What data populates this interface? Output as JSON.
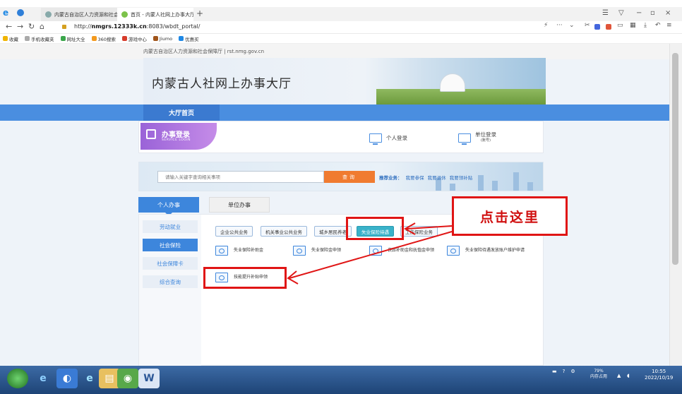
{
  "browser": {
    "tabs": [
      {
        "title": "内蒙古自治区人力资源和社会...",
        "close": "×"
      },
      {
        "title": "首页 - 内蒙人社网上办事大厅",
        "close": "×"
      }
    ],
    "new_tab": "+",
    "url_prefix": "http://",
    "url_host": "nmgrs.12333k.cn",
    "url_rest": ":8083/wbdt_portal/",
    "bookmarks": [
      "收藏",
      "手机收藏夹",
      "网址大全",
      "360搜索",
      "游戏中心",
      "Jiumo",
      "优惠买"
    ]
  },
  "site": {
    "gov_bar": "内蒙古自治区人力资源和社会保障厅  |  rst.nmg.gov.cn",
    "title": "内蒙古人社网上办事大厅",
    "nav_home": "大厅首页"
  },
  "login": {
    "title": "办事登录",
    "subtitle": "SERVICE LOGIN",
    "personal": "个人登录",
    "unit": "单位登录",
    "unit_sub": "(账号)"
  },
  "search": {
    "placeholder": "请输入关键字查询相关事项",
    "button": "查询",
    "recommend_label": "推荐业务：",
    "recommend_items": [
      "我要参保",
      "我要退休",
      "我要领补贴"
    ]
  },
  "tabs": {
    "personal": "个人办事",
    "unit": "单位办事"
  },
  "side_menu": [
    "劳动就业",
    "社会保险",
    "社会保障卡",
    "综合查询"
  ],
  "categories": [
    "企业公共业务",
    "机关事业公共业务",
    "城乡居民养老",
    "失业保险待遇",
    "工伤保险业务"
  ],
  "items": [
    "失业保险补助金",
    "失业保险金申领",
    "丧葬补助金和抚恤金申领",
    "失业保险待遇发放账户维护申请",
    "技能提升补贴申领"
  ],
  "annotation": "点击这里",
  "taskbar": {
    "tray": [
      "79%",
      "内存占用"
    ],
    "time": "10:55",
    "date": "2022/10/19"
  },
  "colors": {
    "accent": "#4a8ee0",
    "active_category": "#3ab2c9",
    "search_button": "#f07b30",
    "annotation_red": "#e01515"
  }
}
